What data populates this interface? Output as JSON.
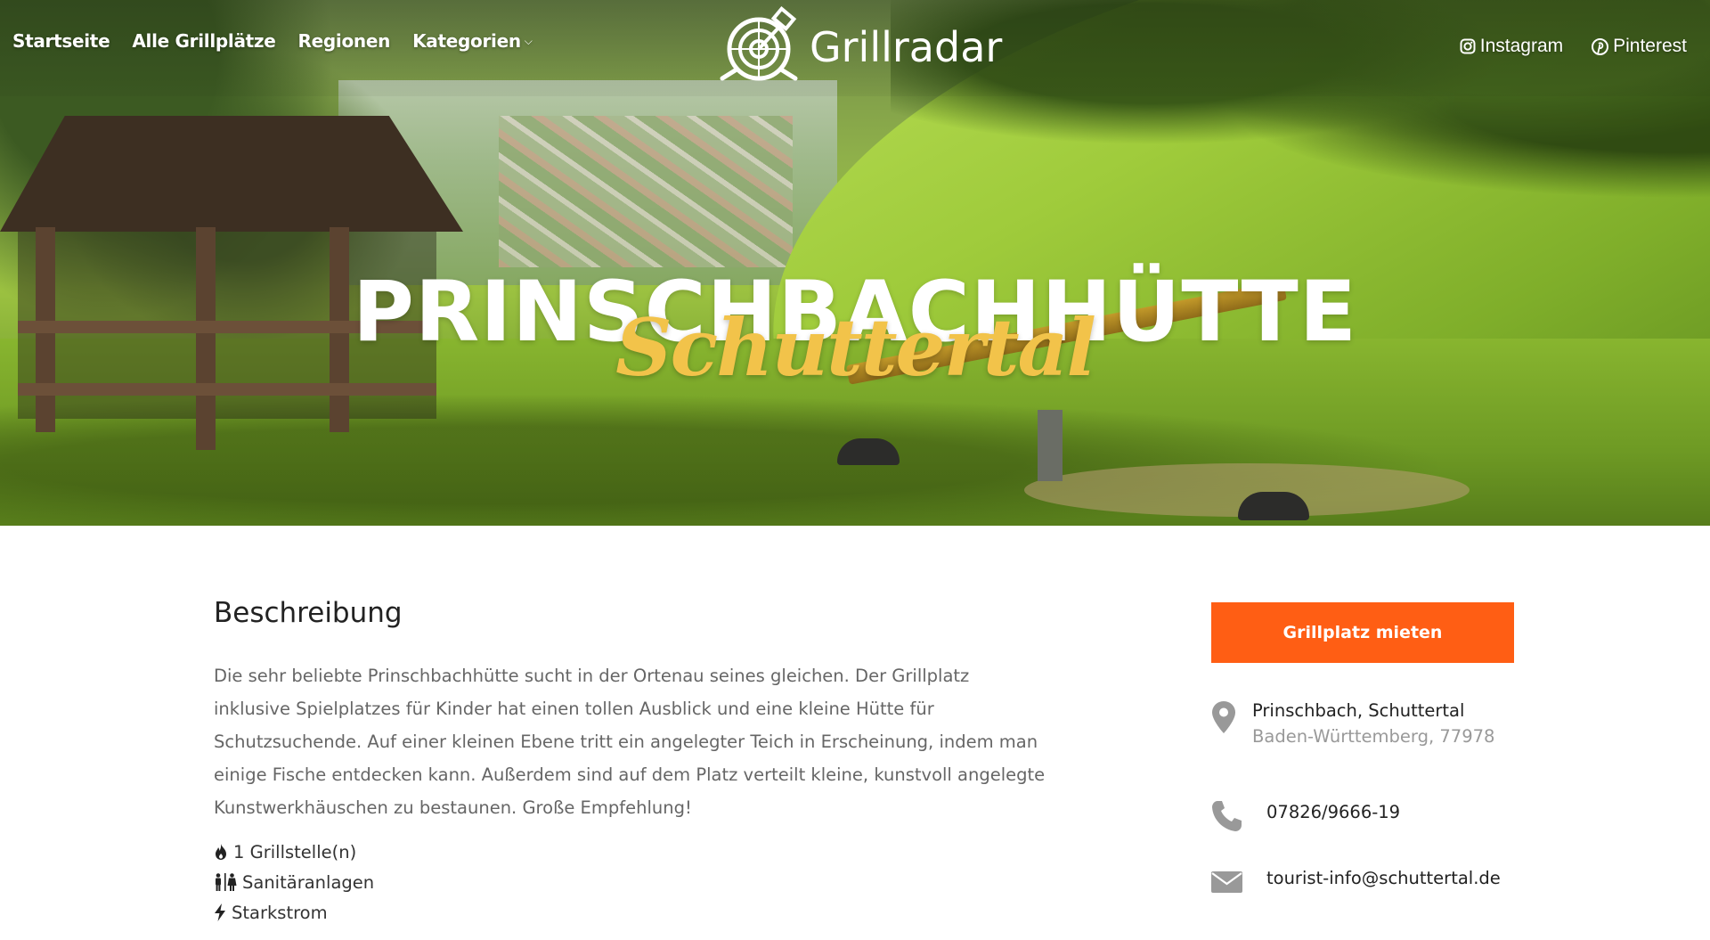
{
  "nav": {
    "items": [
      {
        "label": "Startseite"
      },
      {
        "label": "Alle Grillplätze"
      },
      {
        "label": "Regionen"
      },
      {
        "label": "Kategorien",
        "has_dropdown": true
      }
    ]
  },
  "logo": {
    "text": "Grillradar",
    "icon": "radar-icon"
  },
  "social": {
    "instagram": {
      "label": "Instagram",
      "icon": "instagram-icon"
    },
    "pinterest": {
      "label": "Pinterest",
      "icon": "pinterest-icon"
    }
  },
  "hero": {
    "title": "PRINSCHBACHHÜTTE",
    "subtitle": "Schuttertal"
  },
  "description": {
    "heading": "Beschreibung",
    "text": "Die sehr beliebte Prinschbachhütte sucht in der Ortenau seines gleichen. Der Grillplatz inklusive Spielplatzes für Kinder hat einen tollen Ausblick und eine kleine Hütte für Schutzsuchende. Auf einer kleinen Ebene tritt ein angelegter Teich in Erscheinung, indem man einige Fische entdecken kann. Außerdem sind auf dem Platz verteilt kleine, kunstvoll angelegte Kunstwerkhäuschen zu bestaunen. Große Empfehlung!"
  },
  "features": [
    {
      "icon": "fire-icon",
      "label": "1 Grillstelle(n)"
    },
    {
      "icon": "restroom-icon",
      "label": "Sanitäranlagen"
    },
    {
      "icon": "bolt-icon",
      "label": "Starkstrom"
    }
  ],
  "sidebar": {
    "rent_button": "Grillplatz mieten",
    "location": {
      "line1": "Prinschbach, Schuttertal",
      "line2": "Baden-Württemberg, 77978",
      "icon": "map-pin-icon"
    },
    "phone": {
      "value": "07826/9666-19",
      "icon": "phone-icon"
    },
    "email": {
      "value": "tourist-info@schuttertal.de",
      "icon": "envelope-icon"
    }
  },
  "colors": {
    "accent": "#ff5e14",
    "subtitle": "#f2c34a",
    "body_text": "#666666",
    "icon_gray": "#999999"
  }
}
